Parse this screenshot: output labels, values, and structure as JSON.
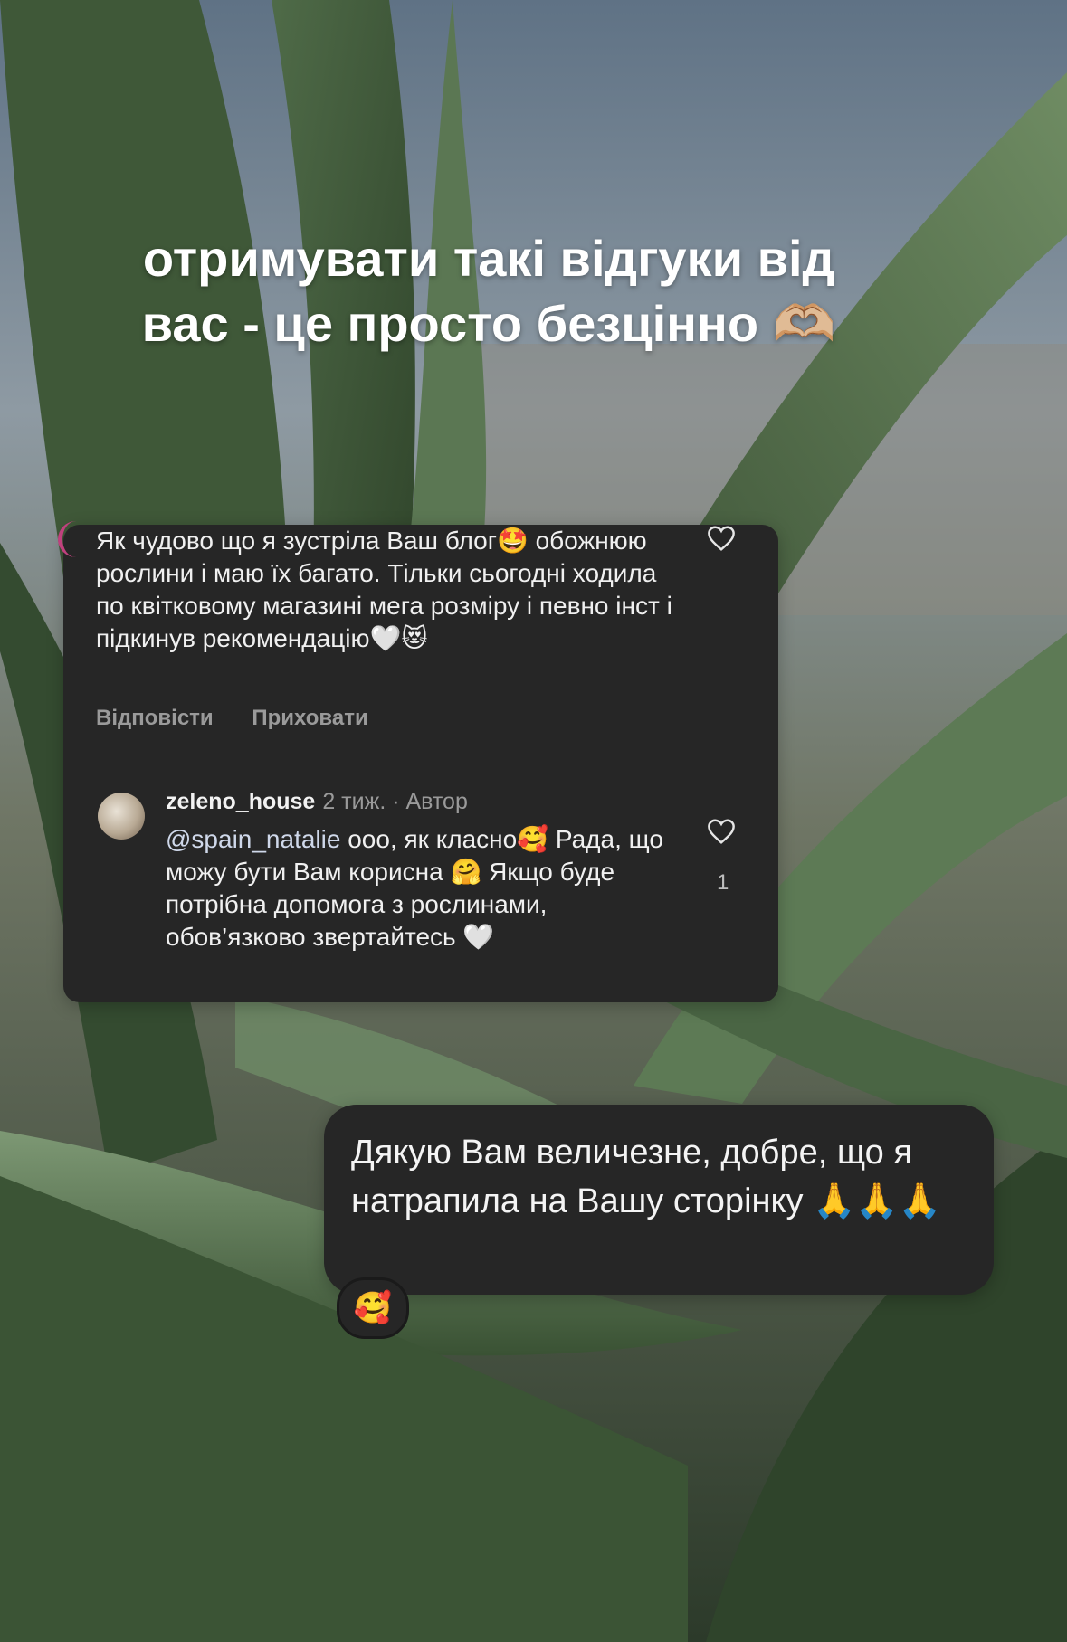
{
  "headline": {
    "line1": "отримувати такі відгуки від",
    "line2": "вас - це просто безцінно 🫶🏼"
  },
  "comment_thread": {
    "first_comment": {
      "text": "Як чудово що я зустріла Ваш блог🤩 обожнюю рослини і маю їх багато. Тільки сьогодні ходила по квітковому магазині мега розміру і певно інст і підкинув рекомендацію🤍😻",
      "reply_label": "Відповісти",
      "hide_label": "Приховати"
    },
    "reply": {
      "username": "zeleno_house",
      "meta": "2 тиж. · Автор",
      "mention": "@spain_natalie",
      "text": " ооо, як класно🥰 Рада, що можу бути Вам корисна 🤗 Якщо буде потрібна допомога з рослинами, обов’язково звертайтесь 🤍",
      "like_count": "1"
    }
  },
  "dm_message": {
    "text": "Дякую Вам величезне, добре, що я натрапила на Вашу сторінку 🙏🙏🙏",
    "reaction": "🥰"
  },
  "icons": [
    "heart-outline-icon",
    "avatar-icon"
  ]
}
